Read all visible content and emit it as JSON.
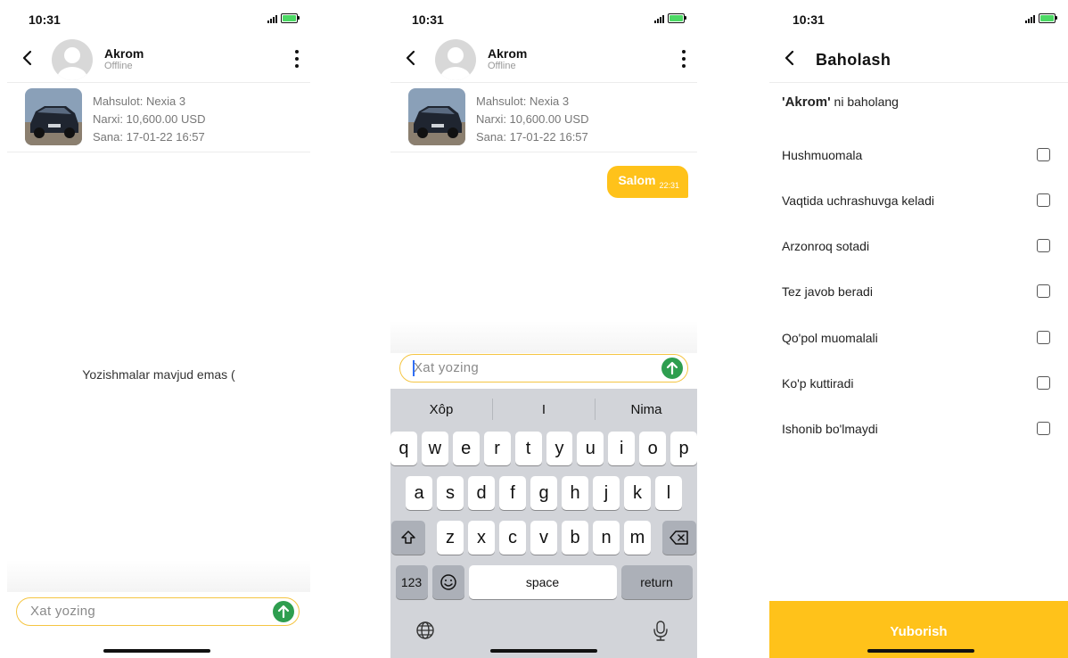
{
  "status": {
    "time": "10:31"
  },
  "contact": {
    "name": "Akrom",
    "presence": "Offline"
  },
  "product": {
    "name_line": "Mahsulot: Nexia 3",
    "price_line": "Narxi: 10,600.00 USD",
    "date_line": "Sana: 17-01-22 16:57"
  },
  "empty_state": "Yozishmalar mavjud emas (",
  "compose": {
    "placeholder": "Xat yozing"
  },
  "message": {
    "text": "Salom",
    "time": "22:31"
  },
  "keyboard": {
    "suggestions": [
      "Xôp",
      "I",
      "Nima"
    ],
    "row1": [
      "q",
      "w",
      "e",
      "r",
      "t",
      "y",
      "u",
      "i",
      "o",
      "p"
    ],
    "row2": [
      "a",
      "s",
      "d",
      "f",
      "g",
      "h",
      "j",
      "k",
      "l"
    ],
    "row3": [
      "z",
      "x",
      "c",
      "v",
      "b",
      "n",
      "m"
    ],
    "numbers_key": "123",
    "space_key": "space",
    "return_key": "return"
  },
  "rating": {
    "title": "Baholash",
    "prompt_name": "'Akrom'",
    "prompt_rest": " ni baholang",
    "options": [
      "Hushmuomala",
      "Vaqtida uchrashuvga keladi",
      "Arzonroq sotadi",
      "Tez javob beradi",
      "Qo'pol muomalali",
      "Ko'p kuttiradi",
      "Ishonib bo'lmaydi"
    ],
    "submit_label": "Yuborish"
  },
  "icons": {
    "back": "chevron-left-icon",
    "more": "more-vertical-icon",
    "send": "arrow-up-icon",
    "shift": "shift-icon",
    "backspace": "backspace-icon",
    "emoji": "emoji-icon",
    "globe": "globe-icon",
    "mic": "microphone-icon"
  },
  "colors": {
    "accent": "#ffc21a",
    "send": "#2e9e4f"
  }
}
